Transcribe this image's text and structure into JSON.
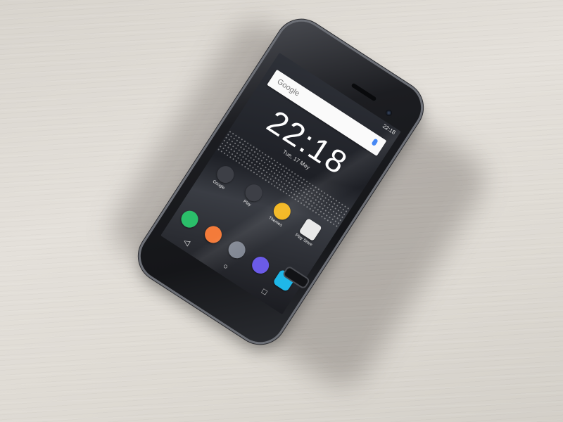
{
  "phone": {
    "statusbar": {
      "time": "22:18"
    },
    "search": {
      "logo_text": "Google"
    },
    "lockscreen": {
      "clock": "22:18",
      "date": "Tue, 17 May"
    },
    "apps": [
      {
        "label": "Google",
        "icon": "google-folder-icon",
        "color": "#3d3f46"
      },
      {
        "label": "Play",
        "icon": "play-folder-icon",
        "color": "#3d3f46"
      },
      {
        "label": "Themes",
        "icon": "themes-icon",
        "color": "#f3b51b"
      },
      {
        "label": "Play Store",
        "icon": "play-store-icon",
        "color": "#e9e9e9"
      }
    ],
    "dock": [
      {
        "icon": "phone-icon",
        "color": "#2bbf6a"
      },
      {
        "icon": "messaging-icon",
        "color": "#f47b3a"
      },
      {
        "icon": "app-drawer-icon",
        "color": "#7f8591"
      },
      {
        "icon": "browser-icon",
        "color": "#6b5be8"
      },
      {
        "icon": "camera-icon",
        "color": "#1fb7e8"
      }
    ],
    "navbar": {
      "back": "◁",
      "home": "○",
      "recents": "□"
    }
  }
}
